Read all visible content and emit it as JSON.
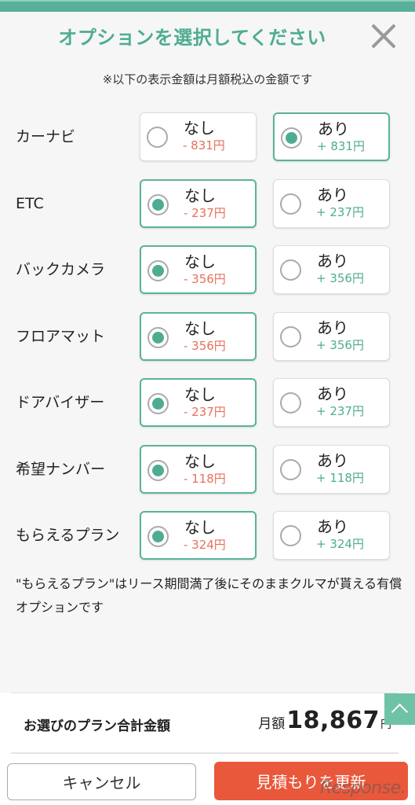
{
  "header": {
    "title": "オプションを選択してください",
    "close_icon": "close-icon",
    "note": "※以下の表示金額は月額税込の金額です"
  },
  "options": [
    {
      "label": "カーナビ",
      "none": {
        "name": "なし",
        "price": "- 831円"
      },
      "with": {
        "name": "あり",
        "price": "+ 831円"
      },
      "selected": "with"
    },
    {
      "label": "ETC",
      "none": {
        "name": "なし",
        "price": "- 237円"
      },
      "with": {
        "name": "あり",
        "price": "+ 237円"
      },
      "selected": "none"
    },
    {
      "label": "バックカメラ",
      "none": {
        "name": "なし",
        "price": "- 356円"
      },
      "with": {
        "name": "あり",
        "price": "+ 356円"
      },
      "selected": "none"
    },
    {
      "label": "フロアマット",
      "none": {
        "name": "なし",
        "price": "- 356円"
      },
      "with": {
        "name": "あり",
        "price": "+ 356円"
      },
      "selected": "none"
    },
    {
      "label": "ドアバイザー",
      "none": {
        "name": "なし",
        "price": "- 237円"
      },
      "with": {
        "name": "あり",
        "price": "+ 237円"
      },
      "selected": "none"
    },
    {
      "label": "希望ナンバー",
      "none": {
        "name": "なし",
        "price": "- 118円"
      },
      "with": {
        "name": "あり",
        "price": "+ 118円"
      },
      "selected": "none"
    },
    {
      "label": "もらえるプラン",
      "none": {
        "name": "なし",
        "price": "- 324円"
      },
      "with": {
        "name": "あり",
        "price": "+ 324円"
      },
      "selected": "none"
    }
  ],
  "footnote": "\"もらえるプラン\"はリース期間満了後にそのままクルマが貰える有償オプションです",
  "summary": {
    "label": "お選びのプラン合計金額",
    "prefix": "月額",
    "amount": "18,867",
    "unit": "円"
  },
  "buttons": {
    "cancel": "キャンセル",
    "update": "見積もりを更新"
  },
  "scroll_top_icon": "chevron-up-icon",
  "watermark": "Response.",
  "colors": {
    "accent": "#4fac93",
    "minus": "#e8705a",
    "update_button": "#e9583a",
    "top_bar": "#58b09a"
  }
}
